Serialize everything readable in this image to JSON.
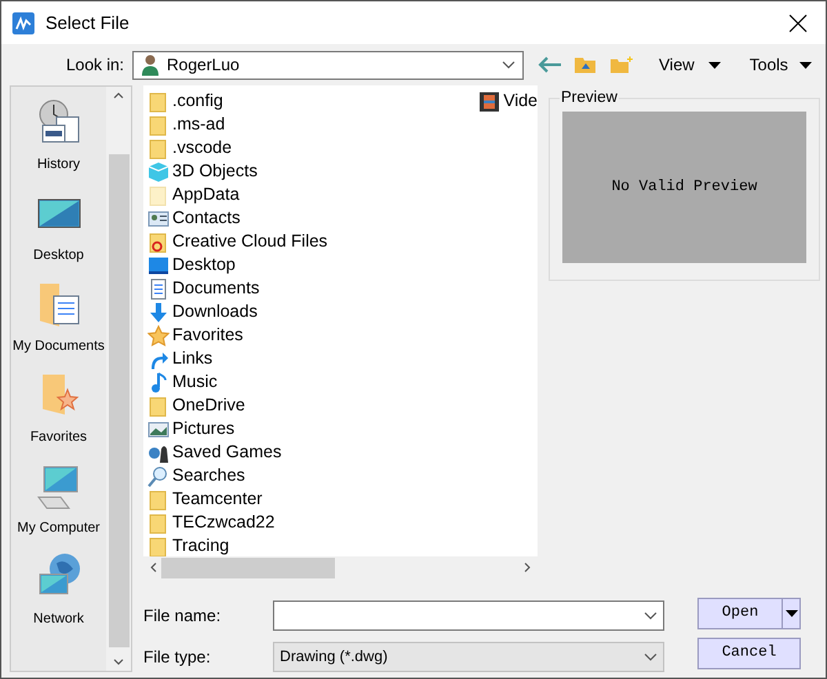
{
  "window": {
    "title": "Select File"
  },
  "look_in": {
    "label": "Look in:",
    "value": "RogerLuo"
  },
  "toolbar": {
    "view": "View",
    "tools": "Tools"
  },
  "places": [
    {
      "label": "History",
      "kind": "history"
    },
    {
      "label": "Desktop",
      "kind": "desktop"
    },
    {
      "label": "My Documents",
      "kind": "documents"
    },
    {
      "label": "Favorites",
      "kind": "favorites"
    },
    {
      "label": "My Computer",
      "kind": "computer"
    },
    {
      "label": "Network",
      "kind": "network"
    }
  ],
  "files": [
    {
      "name": ".config",
      "kind": "folder"
    },
    {
      "name": ".ms-ad",
      "kind": "folder"
    },
    {
      "name": ".vscode",
      "kind": "folder"
    },
    {
      "name": "3D Objects",
      "kind": "cube"
    },
    {
      "name": "AppData",
      "kind": "hidden"
    },
    {
      "name": "Contacts",
      "kind": "contacts"
    },
    {
      "name": "Creative Cloud Files",
      "kind": "cloud"
    },
    {
      "name": "Desktop",
      "kind": "desktop"
    },
    {
      "name": "Documents",
      "kind": "documents"
    },
    {
      "name": "Downloads",
      "kind": "downloads"
    },
    {
      "name": "Favorites",
      "kind": "star"
    },
    {
      "name": "Links",
      "kind": "links"
    },
    {
      "name": "Music",
      "kind": "music"
    },
    {
      "name": "OneDrive",
      "kind": "folder"
    },
    {
      "name": "Pictures",
      "kind": "pictures"
    },
    {
      "name": "Saved Games",
      "kind": "games"
    },
    {
      "name": "Searches",
      "kind": "search"
    },
    {
      "name": "Teamcenter",
      "kind": "folder"
    },
    {
      "name": "TECzwcad22",
      "kind": "folder"
    },
    {
      "name": "Tracing",
      "kind": "folder"
    }
  ],
  "files_column_2": [
    {
      "name": "Vide",
      "kind": "video"
    }
  ],
  "preview": {
    "title": "Preview",
    "message": "No Valid Preview"
  },
  "file_name": {
    "label": "File name:"
  },
  "file_type": {
    "label": "File type:",
    "value": "Drawing (*.dwg)"
  },
  "buttons": {
    "open": "Open",
    "cancel": "Cancel"
  }
}
